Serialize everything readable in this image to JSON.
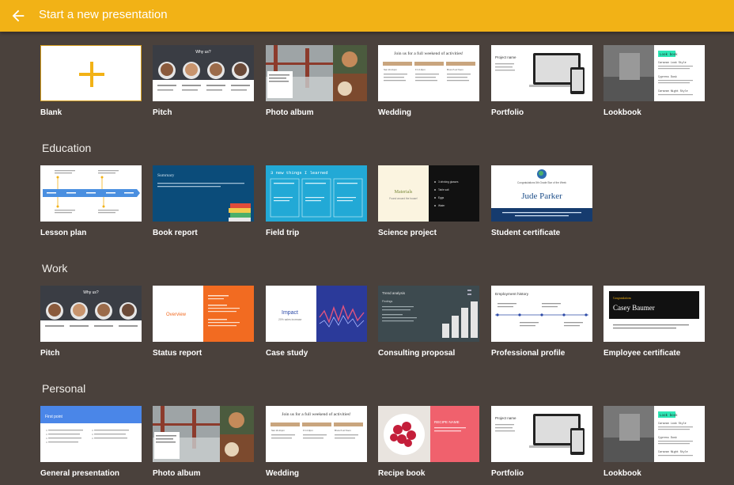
{
  "header": {
    "title": "Start a new presentation",
    "back_icon": "arrow-left-icon",
    "color": "#f2b216"
  },
  "sections": [
    {
      "title": "",
      "items": [
        "Blank",
        "Pitch",
        "Photo album",
        "Wedding",
        "Portfolio",
        "Lookbook"
      ]
    },
    {
      "title": "Education",
      "items": [
        "Lesson plan",
        "Book report",
        "Field trip",
        "Science project",
        "Student certificate"
      ]
    },
    {
      "title": "Work",
      "items": [
        "Pitch",
        "Status report",
        "Case study",
        "Consulting proposal",
        "Professional profile",
        "Employee certificate"
      ]
    },
    {
      "title": "Personal",
      "items": [
        "General presentation",
        "Photo album",
        "Wedding",
        "Recipe book",
        "Portfolio",
        "Lookbook"
      ]
    }
  ],
  "thumb_text": {
    "pitch_title": "Why us?",
    "wedding_title": "Join us for a full weekend of activities!",
    "wedding_cols": [
      "Sat 10-11pm",
      "Fri 2-9pm",
      "Brunch at Noon"
    ],
    "portfolio_title": "Project name",
    "lookbook_tag": "Look book",
    "lookbook_lines": [
      "Caravan Look Style",
      "Cypress Dusk",
      "Caravan Night Style"
    ],
    "summary_title": "Summary",
    "field_trip_title": "3 new things I learned",
    "materials_title": "Materials",
    "materials_sub": "Found around the house!",
    "science_list": [
      "3 drinking glasses",
      "Table salt",
      "Eggs",
      "Water"
    ],
    "certificate_name": "Jude Parker",
    "certificate_head": "Congratulations 5th Grade Star of the Week",
    "overview_title": "Overview",
    "impact_title": "Impact",
    "impact_sub": "20% sales increase",
    "trend_title": "Trend analysis",
    "trend_findings": "Findings",
    "employment_title": "Employment history",
    "employee_cert_top": "Congratulations",
    "employee_cert_name": "Casey Baumer",
    "first_point": "First point",
    "recipe_title": "RECIPE NAME"
  }
}
